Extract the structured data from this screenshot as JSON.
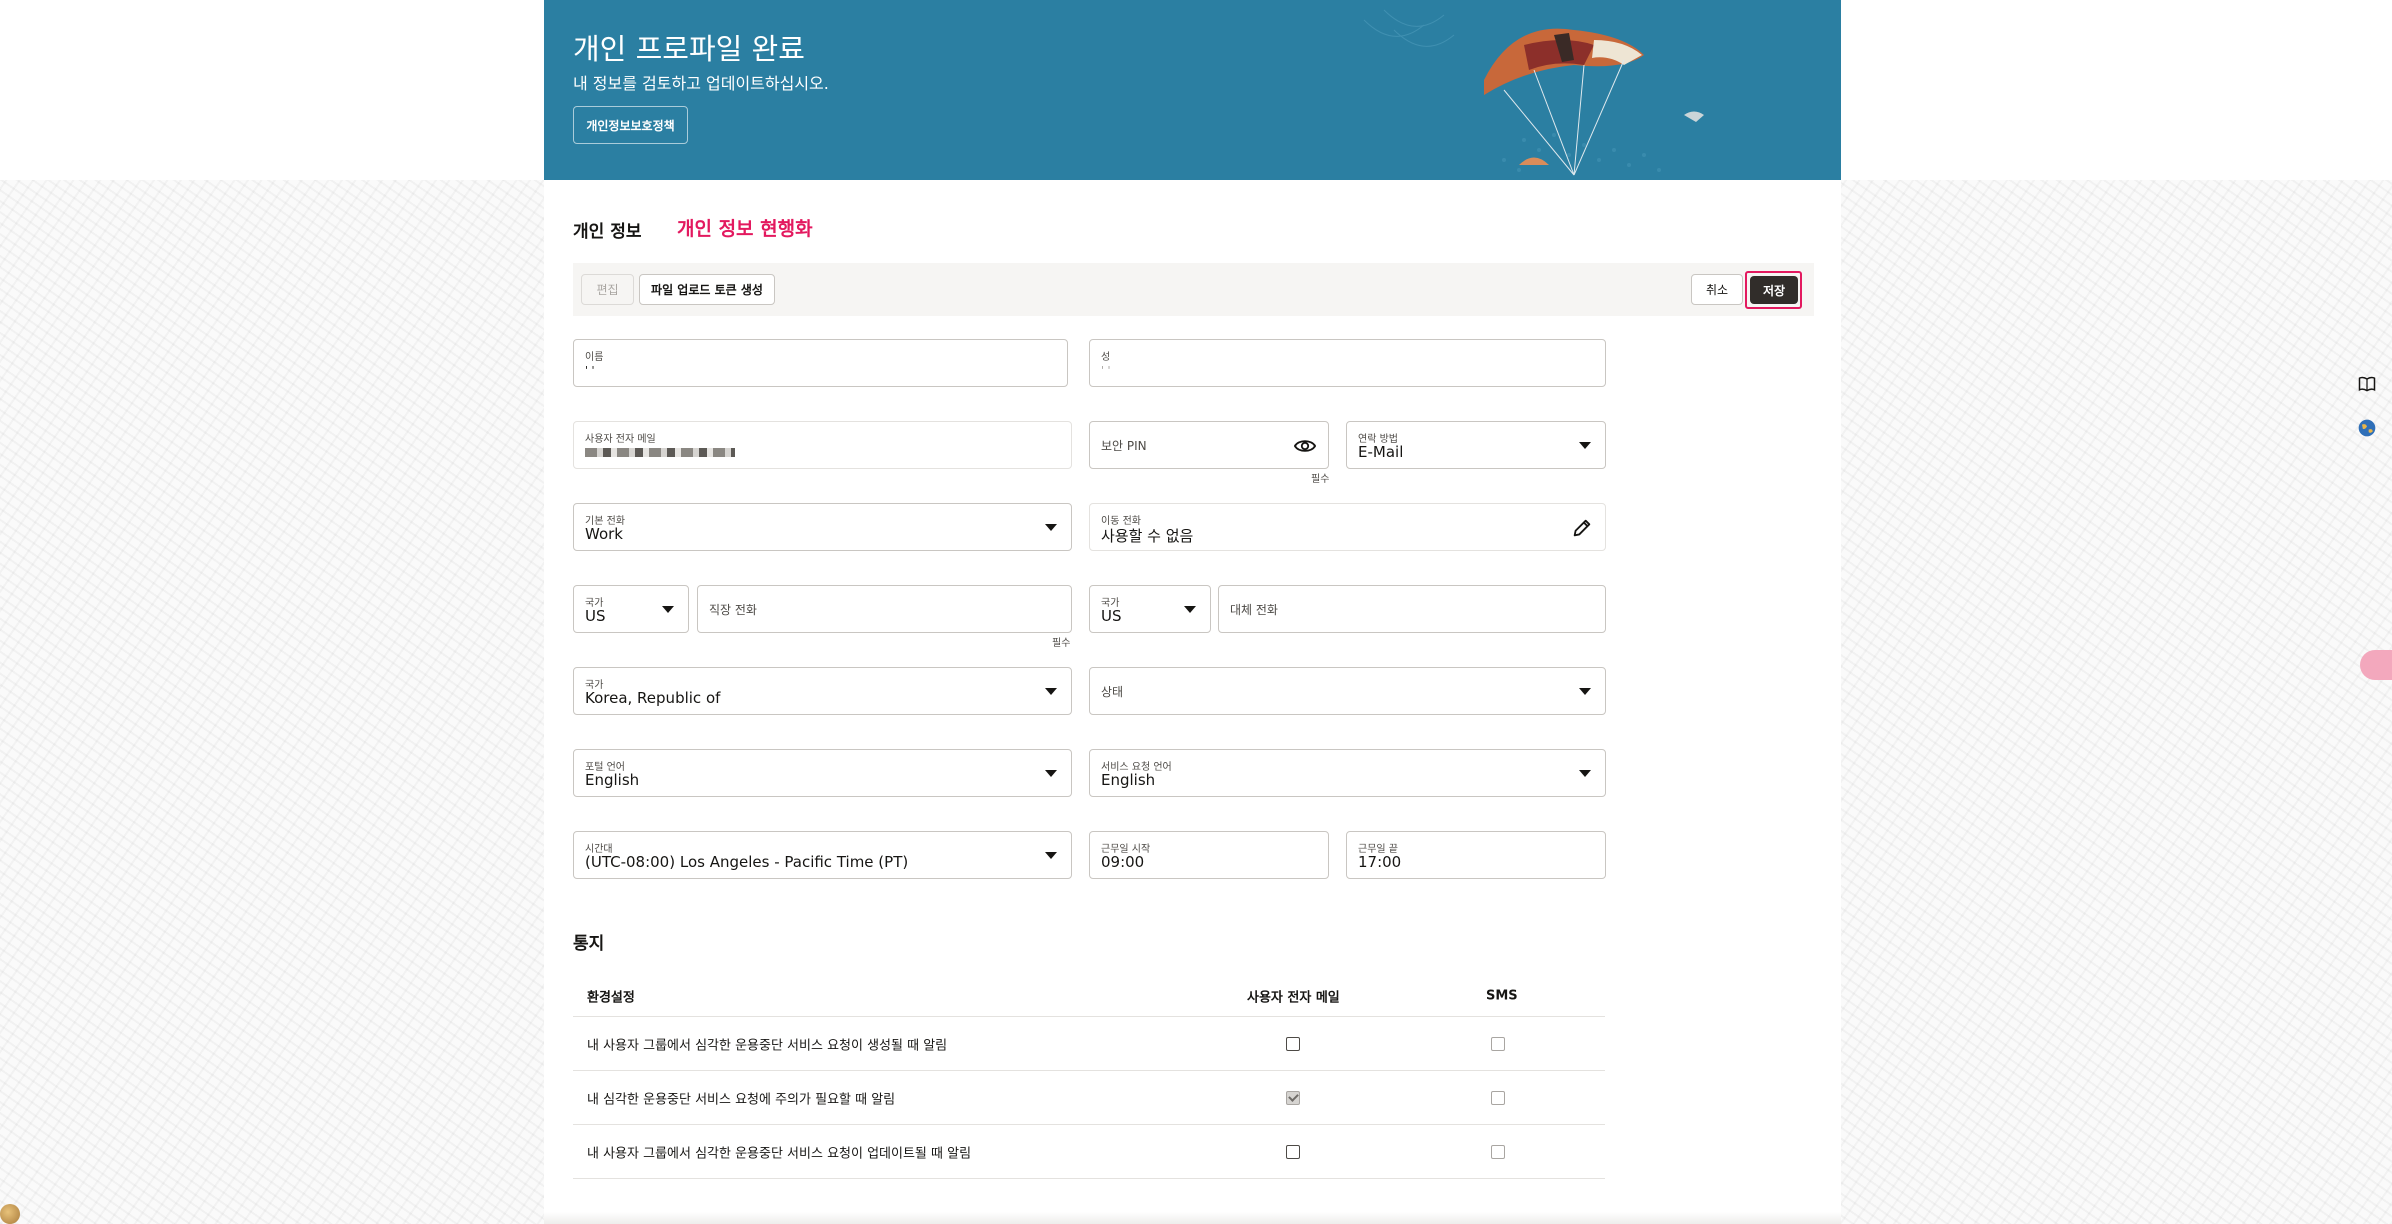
{
  "banner": {
    "title": "개인 프로파일 완료",
    "subtitle": "내 정보를 검토하고 업데이트하십시오.",
    "privacy_button": "개인정보보호정책"
  },
  "section": {
    "title": "개인 정보",
    "annotation": "개인 정보 현행화"
  },
  "toolbar": {
    "edit_label": "편집",
    "token_label": "파일 업로드 토큰 생성",
    "cancel_label": "취소",
    "save_label": "저장"
  },
  "fields": {
    "first_name": {
      "label": "이름",
      "value": "' '"
    },
    "last_name": {
      "label": "성",
      "value": "' '"
    },
    "email": {
      "label": "사용자 전자 메일"
    },
    "pin": {
      "label": "보안 PIN",
      "required": "필수",
      "icon": "eye-icon"
    },
    "contact_method": {
      "label": "연락 방법",
      "value": "E-Mail"
    },
    "primary_phone": {
      "label": "기본 전화",
      "value": "Work"
    },
    "mobile_phone": {
      "label": "이동 전화",
      "value": "사용할 수 없음",
      "icon": "pencil-icon"
    },
    "work_country": {
      "label": "국가",
      "value": "US"
    },
    "work_phone": {
      "placeholder": "직장 전화",
      "required": "필수"
    },
    "alt_country": {
      "label": "국가",
      "value": "US"
    },
    "alt_phone": {
      "placeholder": "대체 전화"
    },
    "country": {
      "label": "국가",
      "value": "Korea, Republic of"
    },
    "state": {
      "placeholder": "상태"
    },
    "portal_lang": {
      "label": "포털 언어",
      "value": "English"
    },
    "sr_lang": {
      "label": "서비스 요청 언어",
      "value": "English"
    },
    "timezone": {
      "label": "시간대",
      "value": "(UTC-08:00) Los Angeles - Pacific Time (PT)"
    },
    "work_start": {
      "label": "근무일 시작",
      "value": "09:00"
    },
    "work_end": {
      "label": "근무일 끝",
      "value": "17:00"
    }
  },
  "notifications": {
    "title": "통지",
    "headers": {
      "pref": "환경설정",
      "email": "사용자 전자 메일",
      "sms": "SMS"
    },
    "rows": [
      {
        "label": "내 사용자 그룹에서 심각한 운용중단 서비스 요청이 생성될 때 알림",
        "email": false,
        "sms": false
      },
      {
        "label": "내 심각한 운용중단 서비스 요청에 주의가 필요할 때 알림",
        "email": true,
        "sms": false
      },
      {
        "label": "내 사용자 그룹에서 심각한 운용중단 서비스 요청이 업데이트될 때 알림",
        "email": false,
        "sms": false
      }
    ]
  },
  "colors": {
    "banner": "#2b7fa2",
    "accent": "#e3195f",
    "primary_button": "#312d2a"
  }
}
